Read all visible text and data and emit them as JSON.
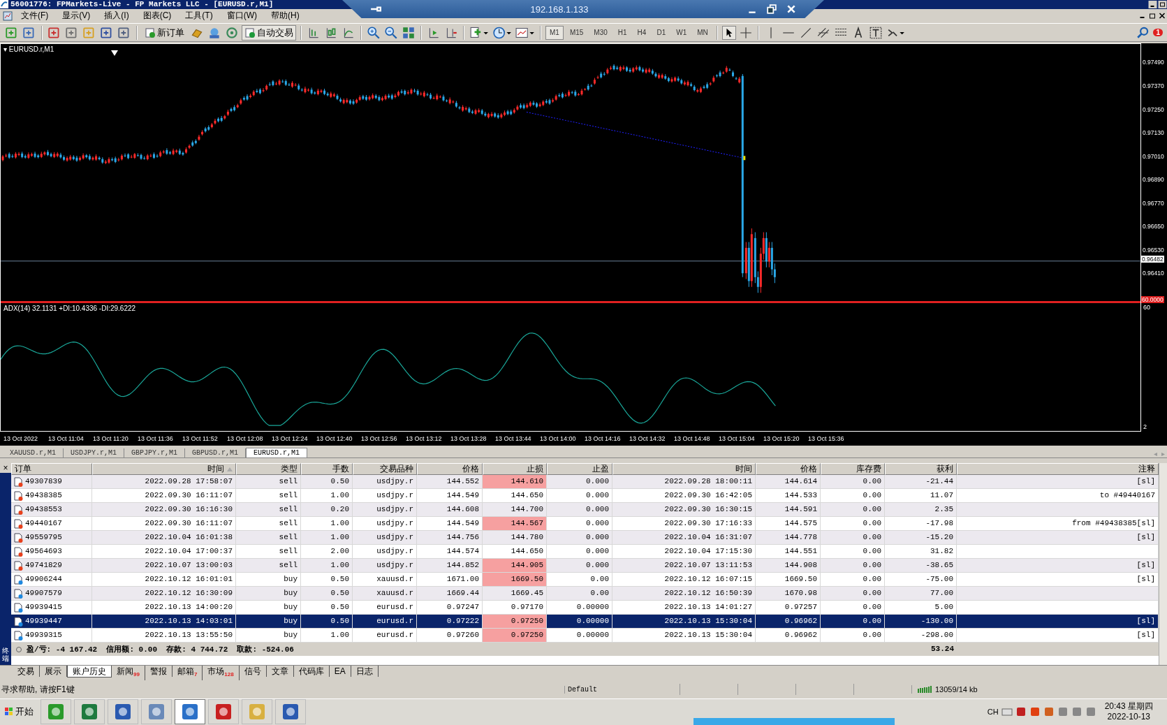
{
  "title_bar": {
    "title": "56001776: FPMarkets-Live - FP Markets LLC - [EURUSD.r,M1]",
    "remote_host": "192.168.1.133"
  },
  "menu": [
    "文件(F)",
    "显示(V)",
    "插入(I)",
    "图表(C)",
    "工具(T)",
    "窗口(W)",
    "帮助(H)"
  ],
  "toolbar": {
    "buttons": [
      {
        "label": "新订单",
        "on": false
      },
      {
        "label": "自动交易",
        "on": true
      }
    ],
    "timeframes": [
      {
        "label": "M1",
        "selected": true
      },
      {
        "label": "M15",
        "selected": false
      },
      {
        "label": "M30",
        "selected": false
      },
      {
        "label": "H1",
        "selected": false
      },
      {
        "label": "H4",
        "selected": false
      },
      {
        "label": "D1",
        "selected": false
      },
      {
        "label": "W1",
        "selected": false
      },
      {
        "label": "MN",
        "selected": false
      }
    ],
    "alert_count": "1"
  },
  "chart": {
    "symbol_marker": "▾",
    "symbol": "EURUSD.r,M1",
    "price_labels": [
      "0.97490",
      "0.97370",
      "0.97250",
      "0.97130",
      "0.97010",
      "0.96890",
      "0.96770",
      "0.96650",
      "0.96530",
      "0.96410"
    ],
    "current_price": "0.96482",
    "indicator": "ADX(14) 32.1131 +DI:10.4336 -DI:29.6222",
    "indicator_level": "60.0000",
    "indicator_labels": [
      "60",
      "2"
    ],
    "time_labels": [
      "13 Oct 2022",
      "13 Oct 11:04",
      "13 Oct 11:20",
      "13 Oct 11:36",
      "13 Oct 11:52",
      "13 Oct 12:08",
      "13 Oct 12:24",
      "13 Oct 12:40",
      "13 Oct 12:56",
      "13 Oct 13:12",
      "13 Oct 13:28",
      "13 Oct 13:44",
      "13 Oct 14:00",
      "13 Oct 14:16",
      "13 Oct 14:32",
      "13 Oct 14:48",
      "13 Oct 15:04",
      "13 Oct 15:20",
      "13 Oct 15:36"
    ]
  },
  "symbol_tabs": [
    {
      "label": "XAUUSD.r,M1",
      "selected": false
    },
    {
      "label": "USDJPY.r,M1",
      "selected": false
    },
    {
      "label": "GBPJPY.r,M1",
      "selected": false
    },
    {
      "label": "GBPUSD.r,M1",
      "selected": false
    },
    {
      "label": "EURUSD.r,M1",
      "selected": true
    }
  ],
  "symbol_tab_scroll": [
    "◂",
    "▸"
  ],
  "terminal": {
    "side_label": "终端",
    "close": "×",
    "columns": [
      "订单",
      "时间",
      "类型",
      "手数",
      "交易品种",
      "价格",
      "止损",
      "止盈",
      "时间",
      "价格",
      "库存费",
      "获利",
      "注释"
    ],
    "rows": [
      {
        "order": "49307839",
        "open_time": "2022.09.28 17:58:07",
        "type": "sell",
        "lots": "0.50",
        "symbol": "usdjpy.r",
        "price": "144.552",
        "sl": "144.610",
        "sl_hit": true,
        "tp": "0.000",
        "close_time": "2022.09.28 18:00:11",
        "close_price": "144.614",
        "swap": "0.00",
        "profit": "-21.44",
        "comment": "[sl]",
        "color": "#e8401c",
        "selected": false
      },
      {
        "order": "49438385",
        "open_time": "2022.09.30 16:11:07",
        "type": "sell",
        "lots": "1.00",
        "symbol": "usdjpy.r",
        "price": "144.549",
        "sl": "144.650",
        "sl_hit": false,
        "tp": "0.000",
        "close_time": "2022.09.30 16:42:05",
        "close_price": "144.533",
        "swap": "0.00",
        "profit": "11.07",
        "comment": "to #49440167",
        "color": "#e8401c",
        "selected": false
      },
      {
        "order": "49438553",
        "open_time": "2022.09.30 16:16:30",
        "type": "sell",
        "lots": "0.20",
        "symbol": "usdjpy.r",
        "price": "144.608",
        "sl": "144.700",
        "sl_hit": false,
        "tp": "0.000",
        "close_time": "2022.09.30 16:30:15",
        "close_price": "144.591",
        "swap": "0.00",
        "profit": "2.35",
        "color": "#e8401c",
        "selected": false
      },
      {
        "order": "49440167",
        "open_time": "2022.09.30 16:11:07",
        "type": "sell",
        "lots": "1.00",
        "symbol": "usdjpy.r",
        "price": "144.549",
        "sl": "144.567",
        "sl_hit": true,
        "tp": "0.000",
        "close_time": "2022.09.30 17:16:33",
        "close_price": "144.575",
        "swap": "0.00",
        "profit": "-17.98",
        "comment": "from #49438385[sl]",
        "color": "#e8401c",
        "selected": false
      },
      {
        "order": "49559795",
        "open_time": "2022.10.04 16:01:38",
        "type": "sell",
        "lots": "1.00",
        "symbol": "usdjpy.r",
        "price": "144.756",
        "sl": "144.780",
        "sl_hit": false,
        "tp": "0.000",
        "close_time": "2022.10.04 16:31:07",
        "close_price": "144.778",
        "swap": "0.00",
        "profit": "-15.20",
        "comment": "[sl]",
        "color": "#e8401c",
        "selected": false
      },
      {
        "order": "49564693",
        "open_time": "2022.10.04 17:00:37",
        "type": "sell",
        "lots": "2.00",
        "symbol": "usdjpy.r",
        "price": "144.574",
        "sl": "144.650",
        "sl_hit": false,
        "tp": "0.000",
        "close_time": "2022.10.04 17:15:30",
        "close_price": "144.551",
        "swap": "0.00",
        "profit": "31.82",
        "color": "#e8401c",
        "selected": false
      },
      {
        "order": "49741829",
        "open_time": "2022.10.07 13:00:03",
        "type": "sell",
        "lots": "1.00",
        "symbol": "usdjpy.r",
        "price": "144.852",
        "sl": "144.905",
        "sl_hit": true,
        "tp": "0.000",
        "close_time": "2022.10.07 13:11:53",
        "close_price": "144.908",
        "swap": "0.00",
        "profit": "-38.65",
        "comment": "[sl]",
        "color": "#e8401c",
        "selected": false
      },
      {
        "order": "49906244",
        "open_time": "2022.10.12 16:01:01",
        "type": "buy",
        "lots": "0.50",
        "symbol": "xauusd.r",
        "price": "1671.00",
        "sl": "1669.50",
        "sl_hit": true,
        "tp": "0.00",
        "close_time": "2022.10.12 16:07:15",
        "close_price": "1669.50",
        "swap": "0.00",
        "profit": "-75.00",
        "comment": "[sl]",
        "color": "#1e88e0",
        "selected": false
      },
      {
        "order": "49907579",
        "open_time": "2022.10.12 16:30:09",
        "type": "buy",
        "lots": "0.50",
        "symbol": "xauusd.r",
        "price": "1669.44",
        "sl": "1669.45",
        "sl_hit": false,
        "tp": "0.00",
        "close_time": "2022.10.12 16:50:39",
        "close_price": "1670.98",
        "swap": "0.00",
        "profit": "77.00",
        "color": "#1e88e0",
        "selected": false
      },
      {
        "order": "49939415",
        "open_time": "2022.10.13 14:00:20",
        "type": "buy",
        "lots": "0.50",
        "symbol": "eurusd.r",
        "price": "0.97247",
        "sl": "0.97170",
        "sl_hit": false,
        "tp": "0.00000",
        "close_time": "2022.10.13 14:01:27",
        "close_price": "0.97257",
        "swap": "0.00",
        "profit": "5.00",
        "color": "#1e88e0",
        "selected": false
      },
      {
        "order": "49939447",
        "open_time": "2022.10.13 14:03:01",
        "type": "buy",
        "lots": "0.50",
        "symbol": "eurusd.r",
        "price": "0.97222",
        "sl": "0.97250",
        "sl_hit": true,
        "tp": "0.00000",
        "close_time": "2022.10.13 15:30:04",
        "close_price": "0.96962",
        "swap": "0.00",
        "profit": "-130.00",
        "comment": "[sl]",
        "color": "#1e88e0",
        "selected": true
      },
      {
        "order": "49939315",
        "open_time": "2022.10.13 13:55:50",
        "type": "buy",
        "lots": "1.00",
        "symbol": "eurusd.r",
        "price": "0.97260",
        "sl": "0.97250",
        "sl_hit": true,
        "tp": "0.00000",
        "close_time": "2022.10.13 15:30:04",
        "close_price": "0.96962",
        "swap": "0.00",
        "profit": "-298.00",
        "comment": "[sl]",
        "color": "#1e88e0",
        "selected": false
      }
    ],
    "summary": {
      "text": "盈/亏: -4 167.42  信用额: 0.00  存款: 4 744.72  取款: -524.06",
      "total": "53.24"
    },
    "tabs": [
      {
        "label": "交易",
        "selected": false
      },
      {
        "label": "展示",
        "selected": false
      },
      {
        "label": "账户历史",
        "selected": true
      },
      {
        "label": "新闻",
        "badge": "99",
        "selected": false
      },
      {
        "label": "警报",
        "selected": false
      },
      {
        "label": "邮箱",
        "badge": "7",
        "selected": false
      },
      {
        "label": "市场",
        "badge": "128",
        "selected": false
      },
      {
        "label": "信号",
        "selected": false
      },
      {
        "label": "文章",
        "selected": false
      },
      {
        "label": "代码库",
        "selected": false
      },
      {
        "label": "EA",
        "selected": false
      },
      {
        "label": "日志",
        "selected": false
      }
    ]
  },
  "status_bar": {
    "help": "寻求帮助, 请按F1键",
    "profile": "Default",
    "traffic": "13059/14 kb"
  },
  "taskbar": {
    "start": "开始",
    "language": "CH",
    "time": "20:43 星期四",
    "date": "2022-10-13"
  }
}
